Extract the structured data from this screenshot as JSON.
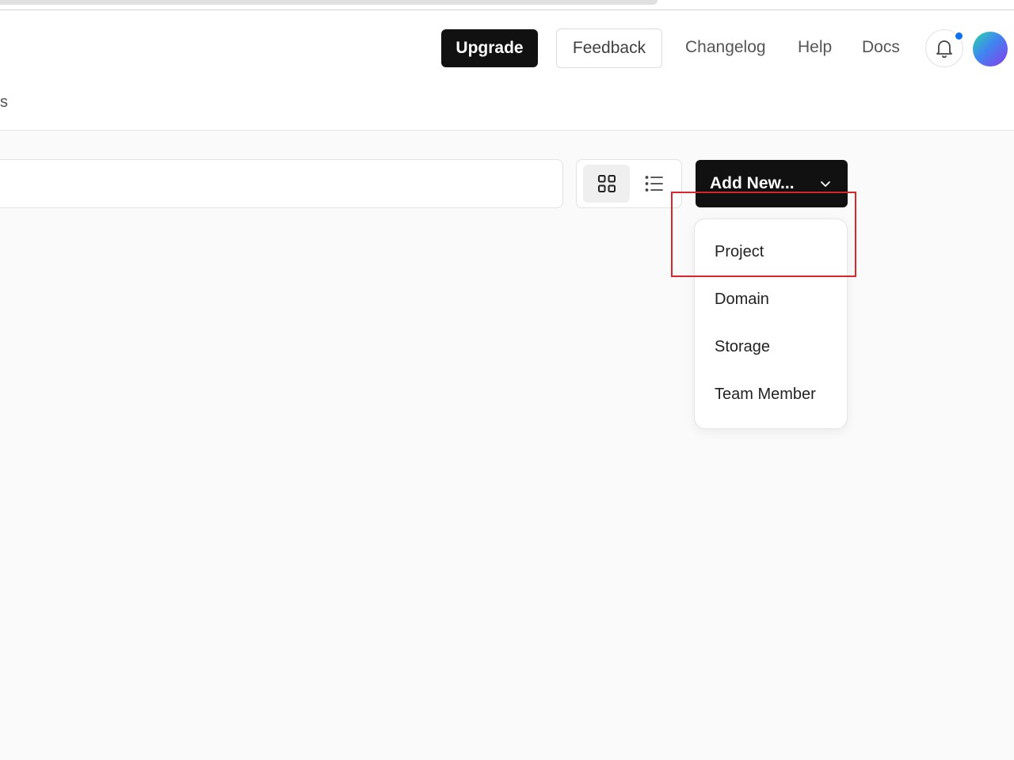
{
  "header": {
    "upgrade_label": "Upgrade",
    "feedback_label": "Feedback",
    "nav": {
      "changelog": "Changelog",
      "help": "Help",
      "docs": "Docs"
    },
    "notification_icon": "bell-icon",
    "notification_dot_color": "#0a72ef",
    "tab_fragment": "s"
  },
  "toolbar": {
    "search_placeholder": "",
    "view_grid_icon": "grid-icon",
    "view_list_icon": "list-icon",
    "add_new_label": "Add New...",
    "add_new_icon": "chevron-down-icon"
  },
  "dropdown": {
    "items": [
      {
        "label": "Project"
      },
      {
        "label": "Domain"
      },
      {
        "label": "Storage"
      },
      {
        "label": "Team Member"
      }
    ]
  },
  "colors": {
    "primary_button": "#111111",
    "highlight": "#d9262c",
    "background": "#fafafa"
  }
}
